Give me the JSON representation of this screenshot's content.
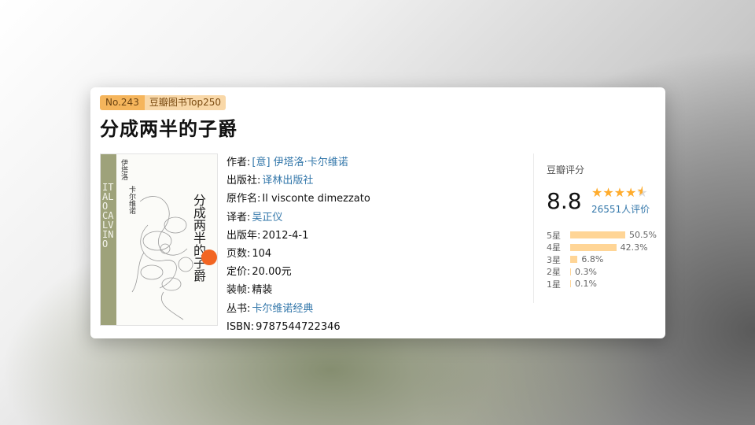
{
  "rank": {
    "number": "No.243",
    "list": "豆瓣图书Top250"
  },
  "book": {
    "title": "分成两半的子爵",
    "cover": {
      "author_cn": "伊塔洛",
      "author_cn2": "卡尔维诺",
      "title": "分成两半的子爵",
      "strip_text": "ITALO CALVINO"
    },
    "info": [
      {
        "label": "作者:",
        "value": "[意] 伊塔洛·卡尔维诺",
        "link": true
      },
      {
        "label": "出版社:",
        "value": "译林出版社",
        "link": true
      },
      {
        "label": "原作名:",
        "value": "Il visconte dimezzato",
        "link": false
      },
      {
        "label": "译者:",
        "value": "吴正仪",
        "link": true
      },
      {
        "label": "出版年:",
        "value": "2012-4-1",
        "link": false
      },
      {
        "label": "页数:",
        "value": "104",
        "link": false
      },
      {
        "label": "定价:",
        "value": "20.00元",
        "link": false
      },
      {
        "label": "装帧:",
        "value": "精装",
        "link": false
      },
      {
        "label": "丛书:",
        "value": "卡尔维诺经典",
        "link": true
      },
      {
        "label": "ISBN:",
        "value": "9787544722346",
        "link": false
      }
    ]
  },
  "rating": {
    "title": "豆瓣评分",
    "score": "8.8",
    "stars": 4.5,
    "votes": "26551人评价",
    "distribution": [
      {
        "label": "5星",
        "pct": "50.5%",
        "value": 50.5
      },
      {
        "label": "4星",
        "pct": "42.3%",
        "value": 42.3
      },
      {
        "label": "3星",
        "pct": "6.8%",
        "value": 6.8
      },
      {
        "label": "2星",
        "pct": "0.3%",
        "value": 0.3
      },
      {
        "label": "1星",
        "pct": "0.1%",
        "value": 0.1
      }
    ],
    "colors": {
      "star": "#ffac2d",
      "bar": "#ffd596",
      "link": "#3377aa"
    }
  }
}
